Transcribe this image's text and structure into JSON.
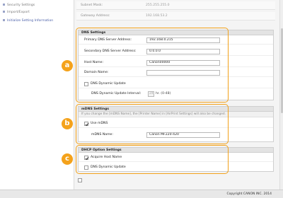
{
  "sidebar": {
    "items": [
      {
        "label": "Security Settings"
      },
      {
        "label": "Import/Export"
      },
      {
        "label": "Initialize Setting Information"
      }
    ]
  },
  "top_rows": [
    {
      "label": "Subnet Mask:",
      "value": "255.255.255.0"
    },
    {
      "label": "Gateway Address:",
      "value": "192.168.53.2"
    }
  ],
  "dns": {
    "title": "DNS Settings",
    "primary_label": "Primary DNS Server Address:",
    "primary_value": "192.168.0.215",
    "secondary_label": "Secondary DNS Server Address:",
    "secondary_value": "0.0.0.0",
    "host_label": "Host Name:",
    "host_value": "Canon00000",
    "domain_label": "Domain Name:",
    "domain_value": "",
    "dynamic_update_label": "DNS Dynamic Update",
    "interval_label": "DNS Dynamic Update Interval:",
    "interval_value": "24",
    "interval_suffix": "hr. (0-48)"
  },
  "mdns": {
    "title": "mDNS Settings",
    "note": "If you change the [mDNS Name], the [Printer Name] in [AirPrint Settings] will also be changed.",
    "use_label": "Use mDNS",
    "name_label": "mDNS Name:",
    "name_value": "Canon MF220-420"
  },
  "dhcp": {
    "title": "DHCP Option Settings",
    "acquire_label": "Acquire Host Name",
    "dynamic_label": "DNS Dynamic Update"
  },
  "callouts": [
    "a",
    "b",
    "c"
  ],
  "footer": {
    "copyright": "Copyright CANON INC. 2014"
  },
  "colors": {
    "callout": "#f4a21b",
    "active_link": "#4a5fa8"
  }
}
